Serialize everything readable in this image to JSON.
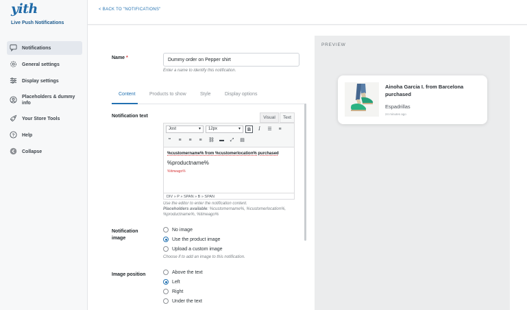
{
  "sidebar": {
    "logo": "yith",
    "plugin_name": "Live Push Notifications",
    "items": [
      {
        "label": "Notifications",
        "icon": "chat-bubble-icon"
      },
      {
        "label": "General settings",
        "icon": "gear-icon"
      },
      {
        "label": "Display settings",
        "icon": "sliders-icon"
      },
      {
        "label": "Placeholders & dummy info",
        "icon": "user-circle-icon"
      },
      {
        "label": "Your Store Tools",
        "icon": "rocket-icon"
      },
      {
        "label": "Help",
        "icon": "help-icon"
      },
      {
        "label": "Collapse",
        "icon": "collapse-icon"
      }
    ]
  },
  "topbar": {
    "back_link": "< BACK TO \"NOTIFICATIONS\""
  },
  "form": {
    "name_label": "Name",
    "name_required": "*",
    "name_value": "Dummy order on Pepper shirt",
    "name_hint": "Enter a name to identify this notification.",
    "tabs": [
      "Content",
      "Products to show",
      "Style",
      "Display options"
    ],
    "notification_text_label": "Notification text",
    "editor": {
      "tab_visual": "Visual",
      "tab_text": "Text",
      "font": "Jost",
      "size": "12px",
      "line1": "%customername% from %customerlocation% purchased",
      "line2": "%productname%",
      "line3": "%timeago%",
      "path": "DIV » P » SPAN » B » SPAN"
    },
    "editor_hint_1": "Use the editor to enter the notification content.",
    "editor_hint_2_bold": "Placeholders available",
    "editor_hint_2": ": %customername%, %customerlocation%, %productname%, %timeago%",
    "image_label": "Notification image",
    "image_options": [
      "No image",
      "Use the product image",
      "Upload a custom image"
    ],
    "image_selected": 1,
    "image_hint": "Choose if to add an image to this notification.",
    "position_label": "Image position",
    "position_options": [
      "Above the text",
      "Left",
      "Right",
      "Under the text"
    ],
    "position_selected": 1
  },
  "preview": {
    "title": "PREVIEW",
    "card_title": "Ainoha Garcia I. from Barcelona purchased",
    "card_product": "Espadrillas",
    "card_time": "24 minutes ago"
  },
  "colors": {
    "accent": "#2271b1",
    "logo": "#1f6aa8",
    "required": "#d63638"
  }
}
